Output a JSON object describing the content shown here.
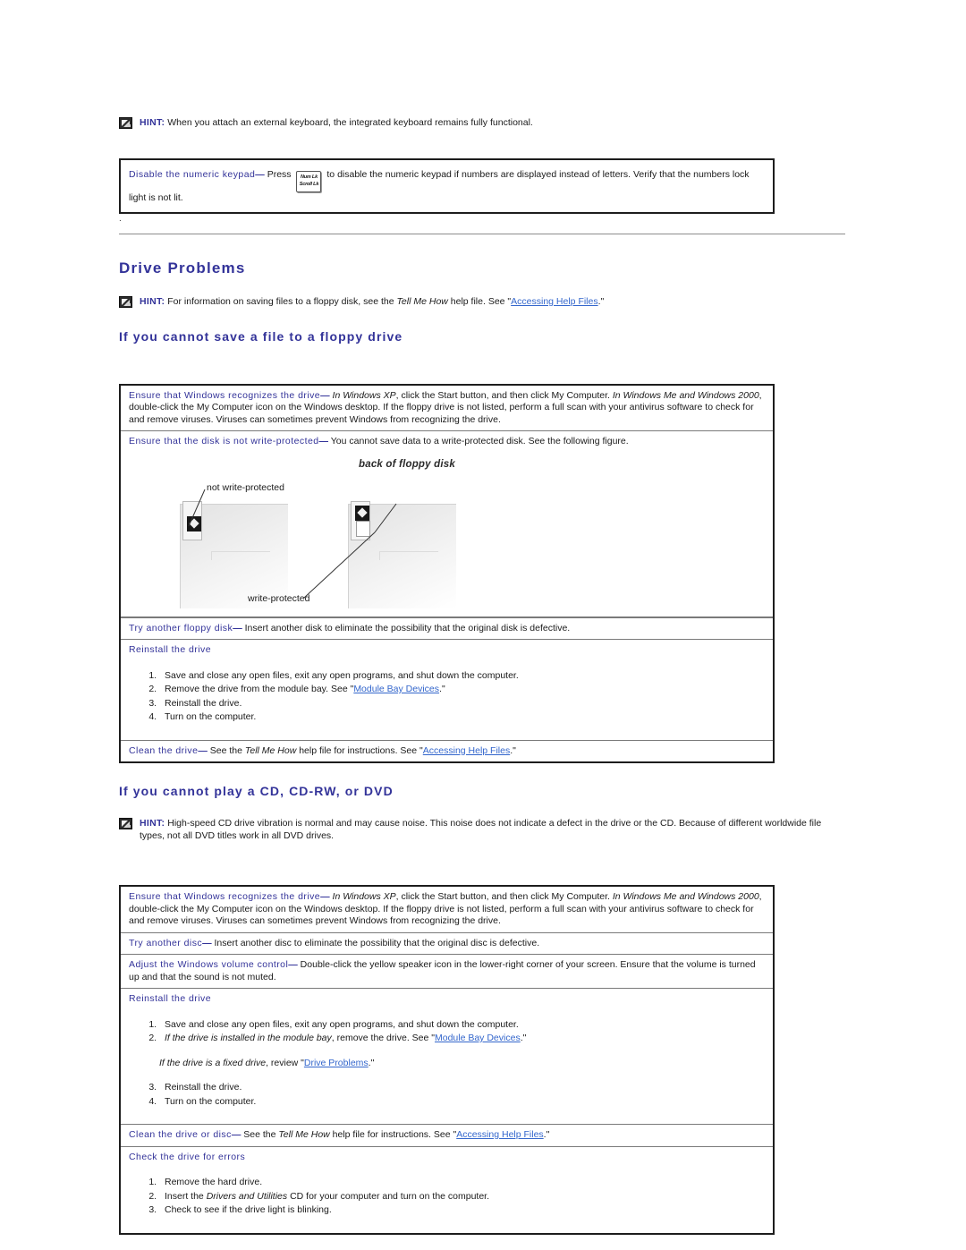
{
  "document": {
    "hint_label": "HINT:",
    "stray_mark": "."
  },
  "top_hint": {
    "label": "HINT:",
    "text": "When you attach an external keyboard, the integrated keyboard remains fully functional."
  },
  "keypad_table": {
    "term": "Disable the numeric keypad",
    "dash": "—",
    "text_before_key": " Press",
    "key": {
      "line1": "Num Lk",
      "line2": "Scroll Lk"
    },
    "text_after_key": "to disable the numeric keypad if numbers are displayed instead of letters. Verify that the numbers lock light is not lit."
  },
  "drive_problems": {
    "heading": "Drive Problems",
    "hint": {
      "label": "HINT:",
      "part1": "For information on saving files to a floppy disk, see the ",
      "italic": "Tell Me How",
      "part2": " help file. See \"",
      "link": "Accessing Help Files",
      "part3": ".\""
    }
  },
  "floppy_section": {
    "heading": "If you cannot save a file to a floppy drive",
    "rows": {
      "recognizes": {
        "term": "Ensure that Windows recognizes the drive",
        "dash": "—",
        "i1": "In Windows XP",
        "t1": ", click the Start button, and then click My Computer. ",
        "i2": "In Windows Me and Windows 2000",
        "t2": ", double-click the My Computer icon on the Windows desktop. If the floppy drive is not listed, perform a full scan with your antivirus software to check for and remove viruses. Viruses can sometimes prevent Windows from recognizing the drive."
      },
      "write_protected": {
        "term": "Ensure that the disk is not write-protected",
        "dash": "—",
        "text": " You cannot save data to a write-protected disk. See the following figure."
      },
      "figure": {
        "caption": "back of floppy disk",
        "label_not_protected": "not write-protected",
        "label_protected": "write-protected"
      },
      "another_disk": {
        "term": "Try another floppy disk",
        "dash": "—",
        "text": " Insert another disk to eliminate the possibility that the original disk is defective."
      },
      "reinstall": {
        "term": "Reinstall the drive",
        "steps": [
          {
            "text": "Save and close any open files, exit any open programs, and shut down the computer."
          },
          {
            "pre": "Remove the drive from the module bay. See \"",
            "link": "Module Bay Devices",
            "post": ".\""
          },
          {
            "text": "Reinstall the drive."
          },
          {
            "text": "Turn on the computer."
          }
        ]
      },
      "clean": {
        "term": "Clean the drive",
        "dash": "—",
        "t1": " See the ",
        "i1": "Tell Me How",
        "t2": " help file for instructions. See \"",
        "link": "Accessing Help Files",
        "t3": ".\""
      }
    }
  },
  "cd_section": {
    "heading": "If you cannot play a CD, CD-RW, or DVD",
    "hint": {
      "label": "HINT:",
      "text": "High-speed CD drive vibration is normal and may cause noise. This noise does not indicate a defect in the drive or the CD. Because of different worldwide file types, not all DVD titles work in all DVD drives."
    },
    "rows": {
      "recognizes": {
        "term": "Ensure that Windows recognizes the drive",
        "dash": "—",
        "i1": "In Windows XP",
        "t1": ", click the Start button, and then click My Computer. ",
        "i2": "In Windows Me and Windows 2000",
        "t2": ", double-click the My Computer icon on the Windows desktop. If the floppy drive is not listed, perform a full scan with your antivirus software to check for and remove viruses. Viruses can sometimes prevent Windows from recognizing the drive."
      },
      "another_disc": {
        "term": "Try another disc",
        "dash": "—",
        "text": " Insert another disc to eliminate the possibility that the original disc is defective."
      },
      "volume": {
        "term": "Adjust the Windows volume control",
        "dash": "—",
        "text": " Double-click the yellow speaker icon in the lower-right corner of your screen. Ensure that the volume is turned up and that the sound is not muted."
      },
      "reinstall": {
        "term": "Reinstall the drive",
        "step1": "Save and close any open files, exit any open programs, and shut down the computer.",
        "step2_i": "If the drive is installed in the module bay",
        "step2_pre": ", remove the drive. See \"",
        "step2_link": "Module Bay Devices",
        "step2_post": ".\"",
        "note_i": "If the drive is a fixed drive",
        "note_pre": ", review \"",
        "note_link": "Drive Problems",
        "note_post": ".\"",
        "step3": "Reinstall the drive.",
        "step4": "Turn on the computer."
      },
      "clean": {
        "term": "Clean the drive or disc",
        "dash": "—",
        "t1": " See the ",
        "i1": "Tell Me How",
        "t2": " help file for instructions. See \"",
        "link": "Accessing Help Files",
        "t3": ".\""
      },
      "check_errors": {
        "term": "Check the drive for errors",
        "step1": "Remove the hard drive.",
        "step2_pre": "Insert the ",
        "step2_i": "Drivers and Utilities",
        "step2_post": " CD for your computer and turn on the computer.",
        "step3": "Check to see if the drive light is blinking."
      }
    }
  },
  "colors": {
    "heading_blue": "#333399",
    "link_blue": "#3366cc",
    "border": "#1d1d1d",
    "rule": "#8c8c8c"
  }
}
